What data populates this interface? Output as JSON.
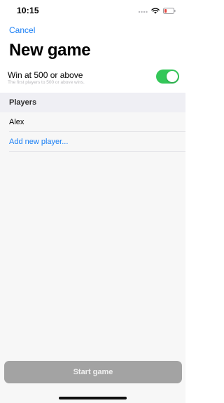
{
  "status_bar": {
    "time": "10:15",
    "icons": [
      "signal-icon",
      "wifi-icon",
      "battery-low-icon"
    ],
    "battery_color": "#e5463f"
  },
  "header": {
    "cancel_label": "Cancel",
    "title": "New game"
  },
  "setting": {
    "label": "Win at 500 or above",
    "sublabel": "The first players to 500 or above wins.",
    "toggle_on": true,
    "toggle_color": "#34c759"
  },
  "players": {
    "section_title": "Players",
    "items": [
      {
        "name": "Alex"
      }
    ],
    "add_label": "Add new player..."
  },
  "footer": {
    "start_label": "Start game",
    "start_button_color": "#a3a3a3"
  },
  "colors": {
    "accent": "#1a7ff5",
    "background": "#f7f7f7",
    "section_header": "#efeff4"
  }
}
